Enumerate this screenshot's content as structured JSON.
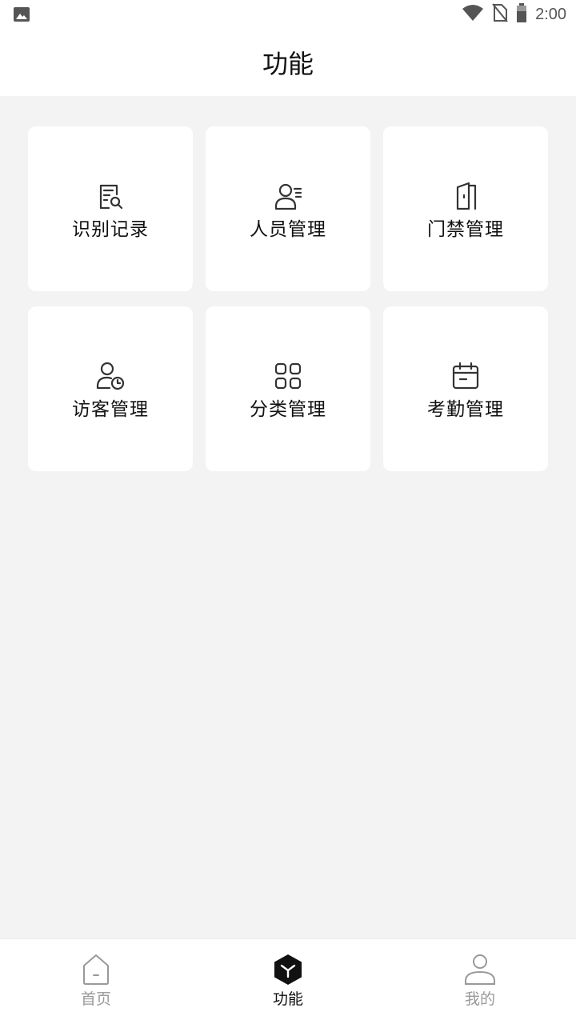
{
  "status_bar": {
    "time": "2:00"
  },
  "header": {
    "title": "功能"
  },
  "functions": [
    {
      "label": "识别记录",
      "icon": "document-search-icon"
    },
    {
      "label": "人员管理",
      "icon": "person-list-icon"
    },
    {
      "label": "门禁管理",
      "icon": "door-icon"
    },
    {
      "label": "访客管理",
      "icon": "person-clock-icon"
    },
    {
      "label": "分类管理",
      "icon": "grid-icon"
    },
    {
      "label": "考勤管理",
      "icon": "calendar-icon"
    }
  ],
  "tabs": [
    {
      "label": "首页",
      "icon": "home-icon",
      "active": false
    },
    {
      "label": "功能",
      "icon": "function-hexagon-icon",
      "active": true
    },
    {
      "label": "我的",
      "icon": "user-icon",
      "active": false
    }
  ],
  "colors": {
    "background": "#f3f3f3",
    "card": "#ffffff",
    "active_tab": "#111111",
    "inactive_tab": "#999999"
  }
}
